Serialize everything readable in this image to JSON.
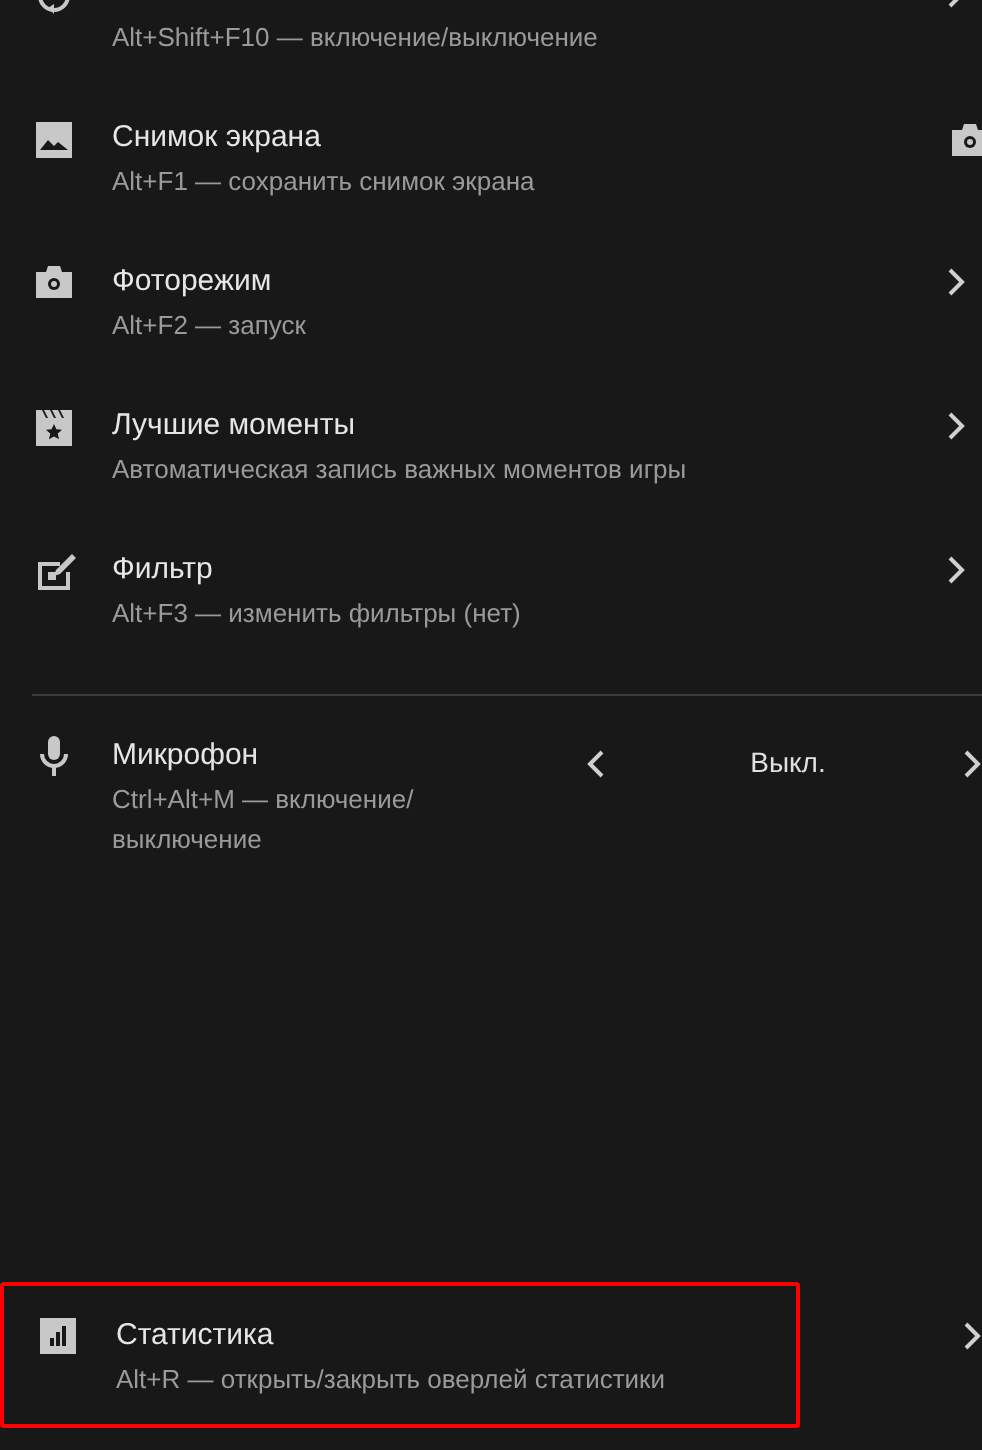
{
  "items": [
    {
      "kind": "nav",
      "subtitle": "Alt+Shift+F10 — включение/выключение",
      "highlighted": false
    },
    {
      "kind": "action",
      "title": "Снимок экрана",
      "subtitle": "Alt+F1 — сохранить снимок экрана",
      "highlighted": false
    },
    {
      "kind": "nav",
      "title": "Фоторежим",
      "subtitle": "Alt+F2 — запуск",
      "highlighted": false
    },
    {
      "kind": "nav",
      "title": "Лучшие моменты",
      "subtitle": "Автоматическая запись важных моментов игры",
      "highlighted": false
    },
    {
      "kind": "nav",
      "title": "Фильтр",
      "subtitle": "Alt+F3 — изменить фильтры (нет)",
      "highlighted": false
    }
  ],
  "microphone": {
    "title": "Микрофон",
    "subtitle": "Ctrl+Alt+M — включение/ выключение",
    "value": "Выкл."
  },
  "statistics": {
    "title": "Статистика",
    "subtitle": "Alt+R — открыть/закрыть оверлей статистики",
    "highlighted": true
  }
}
